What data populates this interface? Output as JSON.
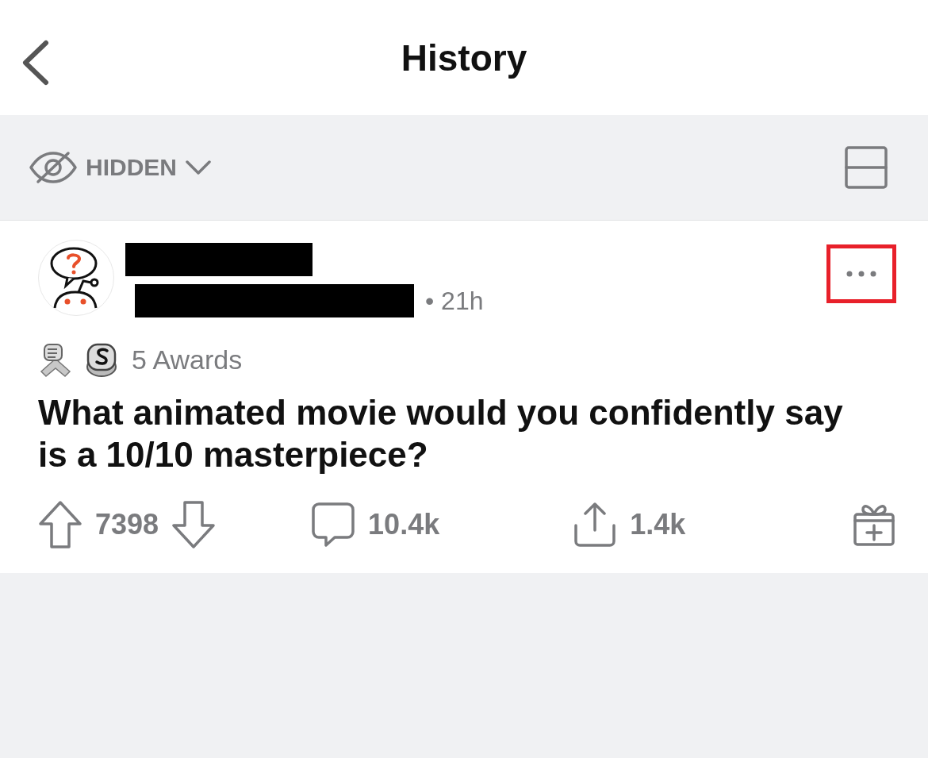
{
  "header": {
    "title": "History"
  },
  "filter": {
    "label": "HIDDEN"
  },
  "post": {
    "time": "• 21h",
    "awards": "5 Awards",
    "title": "What animated movie would you confidently say is a 10/10 masterpiece?",
    "highlighted_menu": true,
    "votes": "7398",
    "comments": "10.4k",
    "shares": "1.4k"
  }
}
